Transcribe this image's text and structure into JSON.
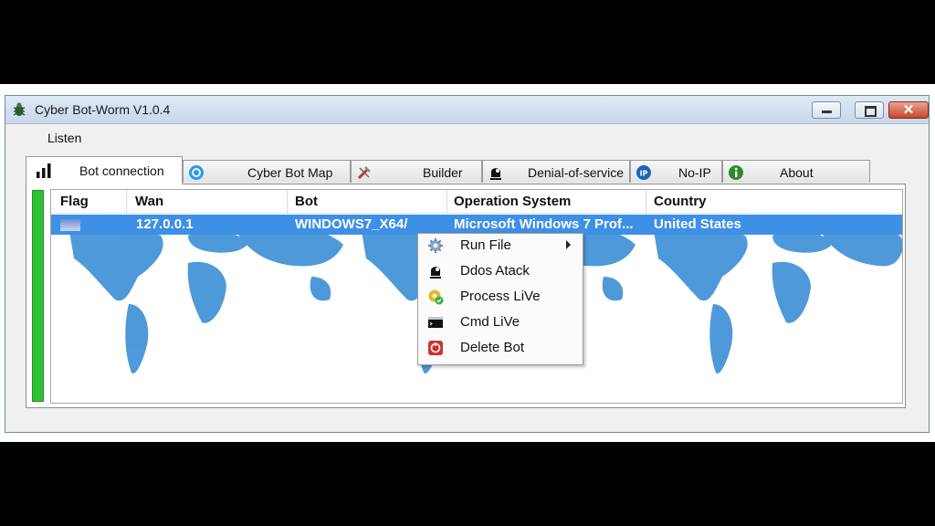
{
  "window": {
    "title": "Cyber Bot-Worm  V1.0.4",
    "icon": "bug-icon"
  },
  "menu": {
    "listen_label": "Listen"
  },
  "tabs": [
    {
      "label": "Bot connection",
      "icon": "signal-bars-icon",
      "active": true
    },
    {
      "label": "Cyber Bot Map",
      "icon": "globe-icon",
      "active": false
    },
    {
      "label": "Builder",
      "icon": "tools-icon",
      "active": false
    },
    {
      "label": "Denial-of-service",
      "icon": "hacker-icon",
      "active": false
    },
    {
      "label": "No-IP",
      "icon": "ip-icon",
      "active": false
    },
    {
      "label": "About",
      "icon": "info-icon",
      "active": false
    }
  ],
  "table": {
    "columns": [
      "Flag",
      "Wan",
      "Bot",
      "Operation System",
      "Country"
    ],
    "rows": [
      {
        "flag": "flag-icon",
        "wan": "127.0.0.1",
        "bot": "WINDOWS7_X64/",
        "os": "Microsoft Windows 7 Prof...",
        "country": "United States",
        "selected": true
      }
    ]
  },
  "context_menu": {
    "items": [
      {
        "label": "Run File",
        "icon": "gear-icon",
        "submenu": true
      },
      {
        "label": "Ddos Atack",
        "icon": "hacker-icon",
        "submenu": false
      },
      {
        "label": "Process LiVe",
        "icon": "process-icon",
        "submenu": false
      },
      {
        "label": "Cmd LiVe",
        "icon": "cmd-icon",
        "submenu": false
      },
      {
        "label": "Delete Bot",
        "icon": "delete-icon",
        "submenu": false
      }
    ]
  },
  "colors": {
    "selection": "#3e8fe6",
    "progress": "#2fc133",
    "map": "#3b8fd6"
  }
}
